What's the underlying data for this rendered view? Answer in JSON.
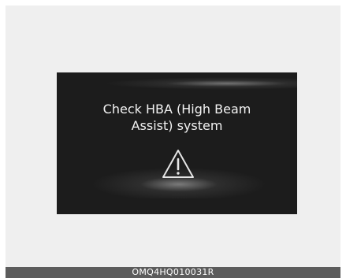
{
  "display": {
    "message_line1": "Check HBA (High Beam",
    "message_line2": "Assist) system",
    "icon": "warning-triangle-icon"
  },
  "caption": {
    "code": "OMQ4HQ010031R"
  },
  "colors": {
    "screen_background": "#1c1c1c",
    "panel_background": "#efefef",
    "caption_bar": "#5c5c5c",
    "text": "#f2f2f2"
  }
}
